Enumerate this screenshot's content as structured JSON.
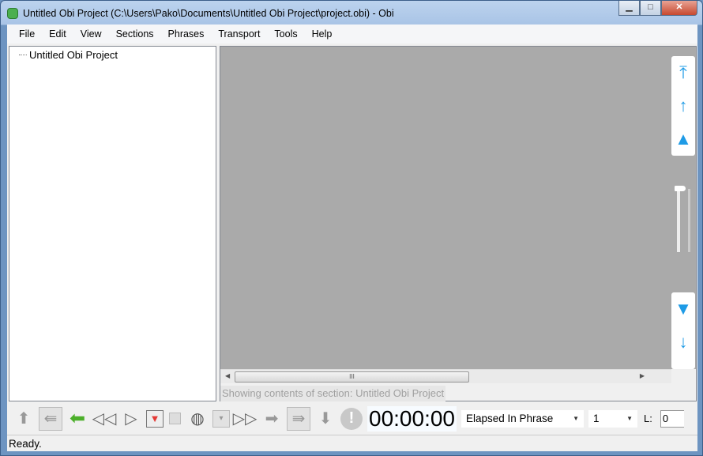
{
  "window": {
    "title": "Untitled Obi Project (C:\\Users\\Pako\\Documents\\Untitled Obi Project\\project.obi) - Obi",
    "min": "▁",
    "max": "□",
    "close": "✕"
  },
  "menu": [
    "File",
    "Edit",
    "View",
    "Sections",
    "Phrases",
    "Transport",
    "Tools",
    "Help"
  ],
  "tree": {
    "root": "Untitled Obi Project"
  },
  "content": {
    "section_status": "Showing contents of section:  Untitled Obi Project",
    "scroll_grip": "III",
    "accent": "#1e9be6"
  },
  "toolbar": {
    "time": "00:00:00",
    "time_mode": "Elapsed In Phrase",
    "level": "1",
    "l_label": "L:",
    "l_value": "0"
  },
  "status": {
    "text": "Ready."
  }
}
